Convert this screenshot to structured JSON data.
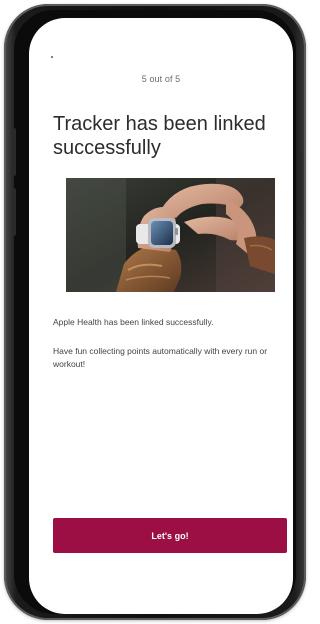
{
  "progress": {
    "step_label": "5 out of 5"
  },
  "header": {
    "title": "Tracker has been linked successfully"
  },
  "illustration": {
    "icon": "smartwatch-photo"
  },
  "content": {
    "paragraphs": [
      "Apple Health has been linked successfully.",
      "Have fun collecting points automatically with every run or workout!"
    ]
  },
  "actions": {
    "primary_label": "Let's go!"
  },
  "theme": {
    "accent": "#9b0f45"
  }
}
